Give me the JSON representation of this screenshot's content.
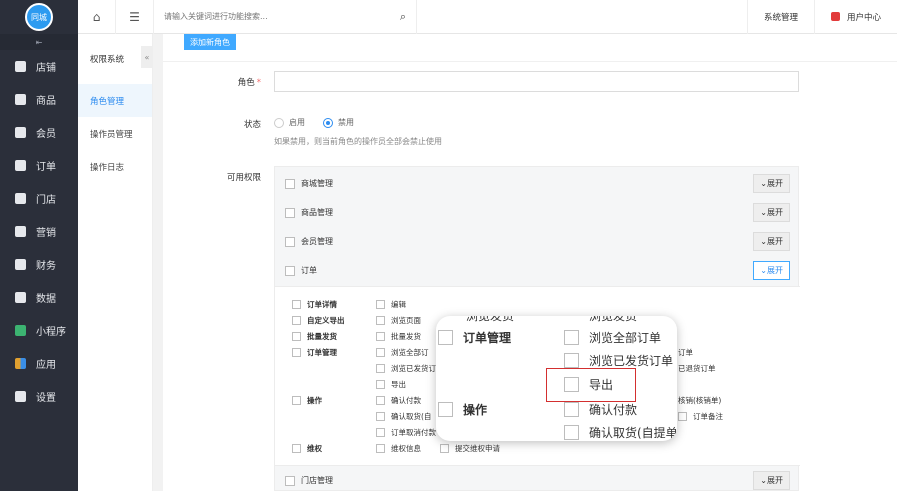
{
  "sidebar": {
    "logo_text": "同城",
    "collapse": "⇤",
    "items": [
      {
        "label": "店铺"
      },
      {
        "label": "商品"
      },
      {
        "label": "会员"
      },
      {
        "label": "订单"
      },
      {
        "label": "门店"
      },
      {
        "label": "营销"
      },
      {
        "label": "财务"
      },
      {
        "label": "数据"
      },
      {
        "label": "小程序"
      },
      {
        "label": "应用"
      },
      {
        "label": "设置"
      }
    ]
  },
  "topbar": {
    "search_placeholder": "请输入关键词进行功能搜索...",
    "system_mgmt": "系统管理",
    "user_center": "用户中心"
  },
  "subnav": {
    "title": "权限系统",
    "toggle": "«",
    "items": [
      {
        "label": "角色管理"
      },
      {
        "label": "操作员管理"
      },
      {
        "label": "操作日志"
      }
    ]
  },
  "main": {
    "add_role_btn": "添加新角色",
    "role_label": "角色",
    "role_required": "*",
    "status_label": "状态",
    "status_enable": "启用",
    "status_disable": "禁用",
    "status_hint": "如果禁用，则当前角色的操作员全部会禁止使用",
    "perm_label": "可用权限",
    "perm_rows": [
      {
        "label": "商城管理",
        "btn": "展开"
      },
      {
        "label": "商品管理",
        "btn": "展开"
      },
      {
        "label": "会员管理",
        "btn": "展开"
      },
      {
        "label": "订单",
        "btn": "展开"
      },
      {
        "label": "门店管理",
        "btn": "展开"
      }
    ],
    "sub": {
      "order_detail": "订单详情",
      "edit": "编辑",
      "custom_export": "自定义导出",
      "browse_page": "浏览页面",
      "batch_ship": "批量发货",
      "batch_ship2": "批量发货",
      "order_mgmt": "订单管理",
      "browse_all": "浏览全部订",
      "browse_shipped": "浏览已发货订",
      "export": "导出",
      "operate": "操作",
      "confirm_pay": "确认付款",
      "confirm_pickup": "确认取货(自",
      "order_cancel_pay": "订单取消付款",
      "right_order": "订单",
      "right_refund": "已退货订单",
      "verify": "核销(核销单)",
      "order_note": "订单备注",
      "rights": "维权",
      "rights_info": "维权信息",
      "submit_rights": "提交维权申请"
    }
  },
  "zoom": {
    "top_left_cut": "浏览发货",
    "top_right_cut": "浏览发货",
    "order_mgmt": "订单管理",
    "browse_all": "浏览全部订单",
    "browse_shipped": "浏览已发货订单",
    "export": "导出",
    "operate": "操作",
    "confirm_pay": "确认付款",
    "confirm_pickup": "确认取货(自提单"
  }
}
